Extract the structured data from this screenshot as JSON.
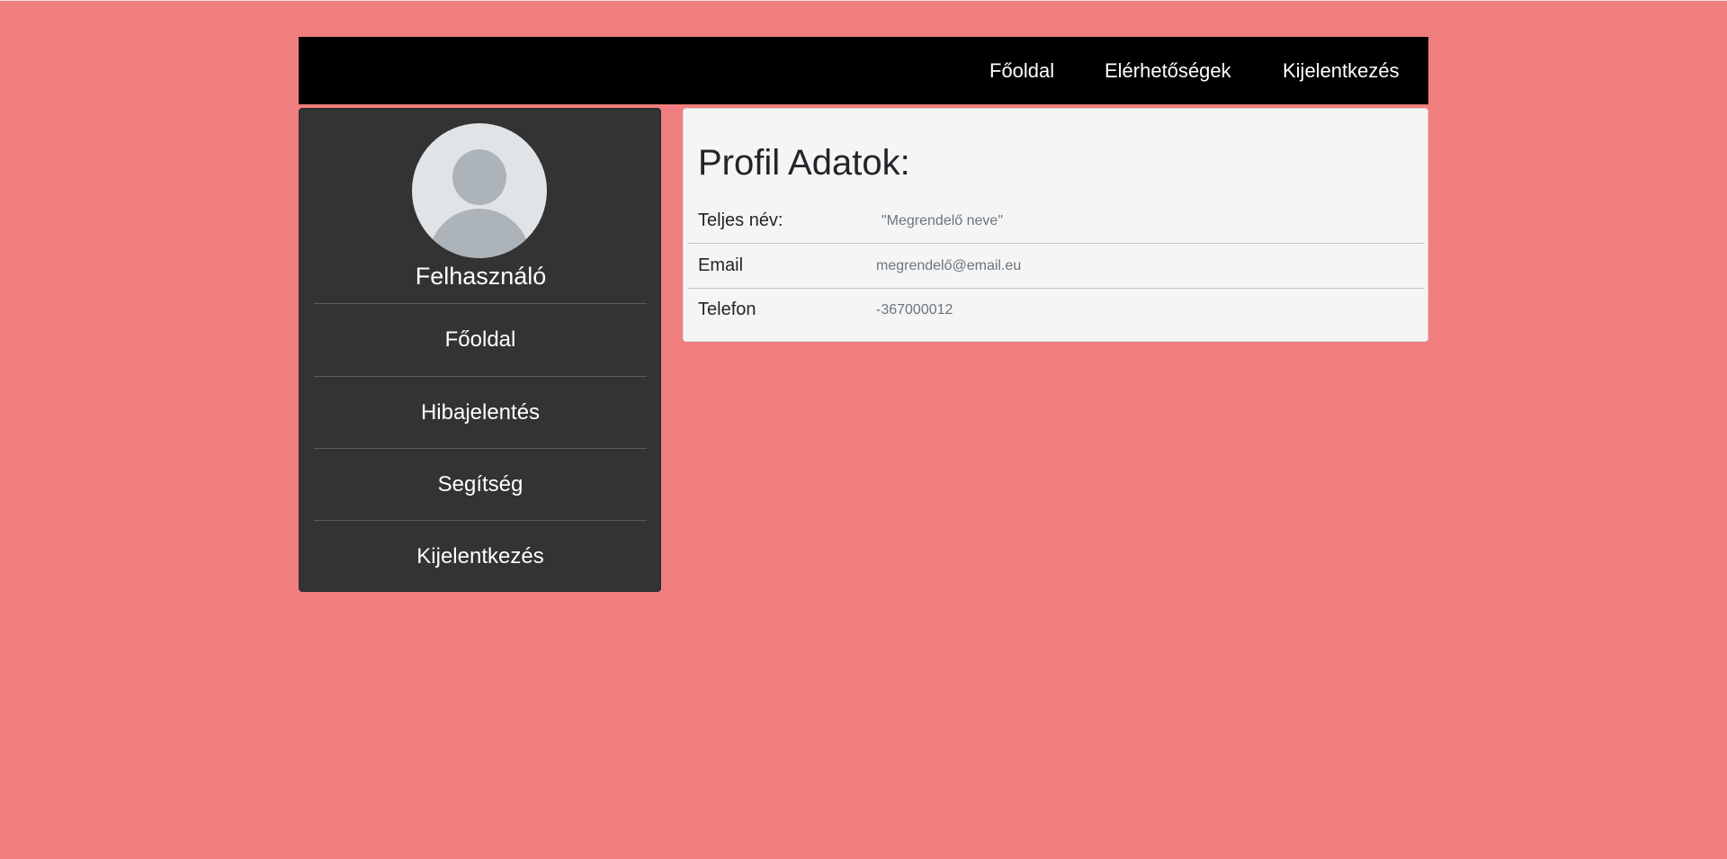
{
  "navbar": {
    "links": [
      {
        "label": "Főoldal"
      },
      {
        "label": "Elérhetőségek"
      },
      {
        "label": "Kijelentkezés"
      }
    ]
  },
  "sidebar": {
    "avatar_icon": "user-avatar-icon",
    "username": "Felhasználó",
    "items": [
      {
        "label": "Főoldal"
      },
      {
        "label": "Hibajelentés"
      },
      {
        "label": "Segítség"
      },
      {
        "label": "Kijelentkezés"
      }
    ]
  },
  "profile": {
    "title": "Profil Adatok:",
    "rows": [
      {
        "label": "Teljes név:",
        "value": "\"Megrendelő neve\""
      },
      {
        "label": "Email",
        "value": "megrendelő@email.eu"
      },
      {
        "label": "Telefon",
        "value": "-367000012"
      }
    ]
  },
  "colors": {
    "page_background": "#f07e7e",
    "navbar_background": "#000000",
    "sidebar_background": "#333333",
    "panel_background": "#f5f5f5"
  }
}
